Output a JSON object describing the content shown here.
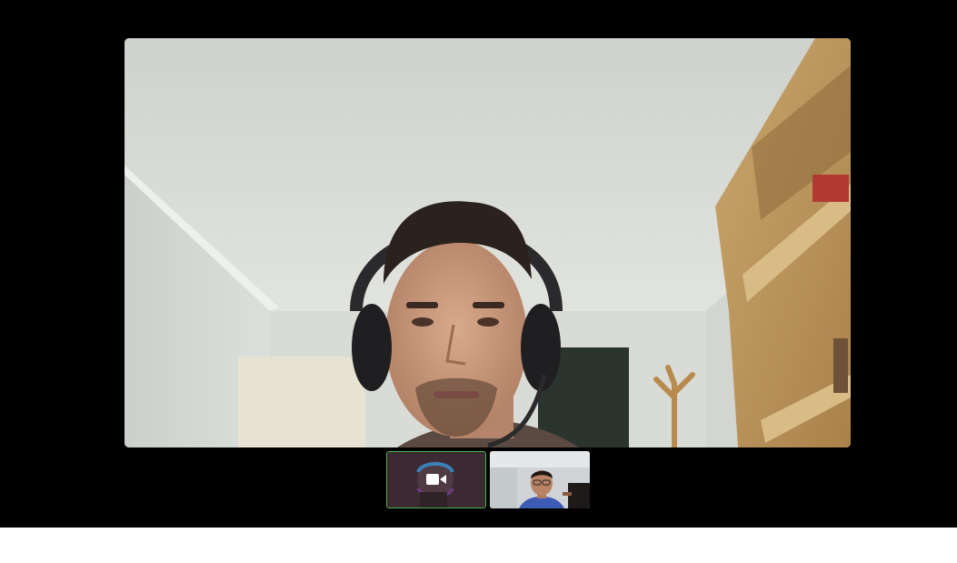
{
  "window": {
    "background": "#000000"
  },
  "main_video": {
    "feed": "remote-participant-speaker",
    "content": "man-with-headset-webcam-feed"
  },
  "thumbnails": [
    {
      "id": "self",
      "active": true,
      "camera_state": "camera-on-icon",
      "highlight_color": "#4caf50"
    },
    {
      "id": "remote-2",
      "active": false,
      "content": "participant-webcam-feed"
    }
  ]
}
